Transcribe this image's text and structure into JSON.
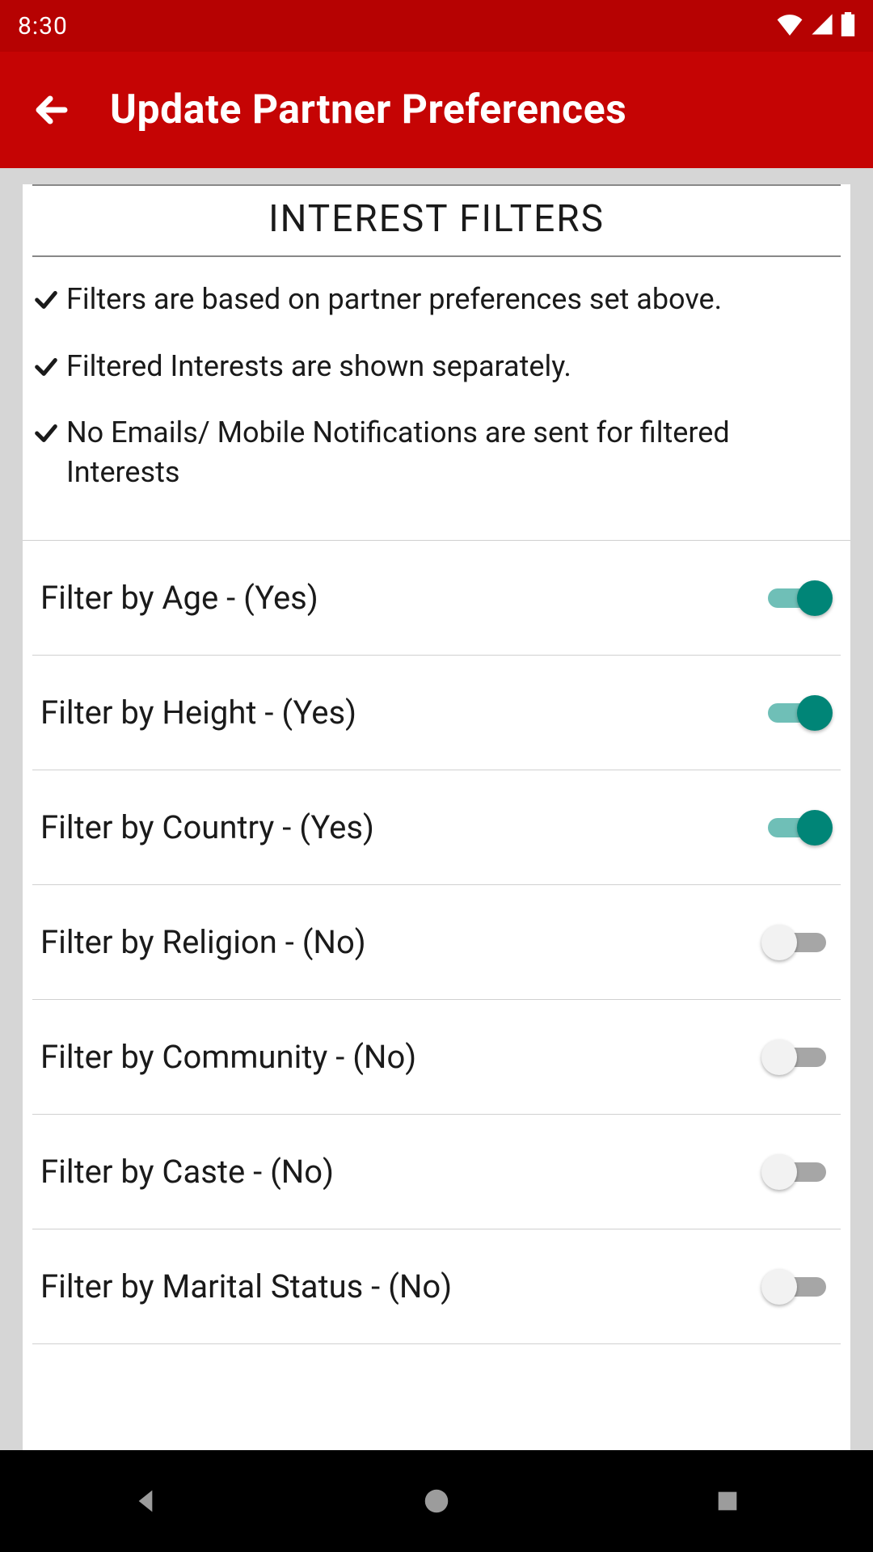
{
  "status": {
    "time": "8:30"
  },
  "header": {
    "title": "Update Partner Preferences"
  },
  "section": {
    "title": "INTEREST FILTERS"
  },
  "notes": [
    {
      "text": "Filters are based on partner preferences set above."
    },
    {
      "text": "Filtered Interests are shown separately."
    },
    {
      "text": "No Emails/ Mobile Notifications are sent for filtered Interests"
    }
  ],
  "filters": [
    {
      "key": "age",
      "label": "Filter by Age - (Yes)",
      "on": true
    },
    {
      "key": "height",
      "label": "Filter by Height - (Yes)",
      "on": true
    },
    {
      "key": "country",
      "label": "Filter by Country - (Yes)",
      "on": true
    },
    {
      "key": "religion",
      "label": "Filter by Religion - (No)",
      "on": false
    },
    {
      "key": "community",
      "label": "Filter by Community - (No)",
      "on": false
    },
    {
      "key": "caste",
      "label": "Filter by Caste - (No)",
      "on": false
    },
    {
      "key": "marital-status",
      "label": "Filter by Marital Status - (No)",
      "on": false
    }
  ]
}
